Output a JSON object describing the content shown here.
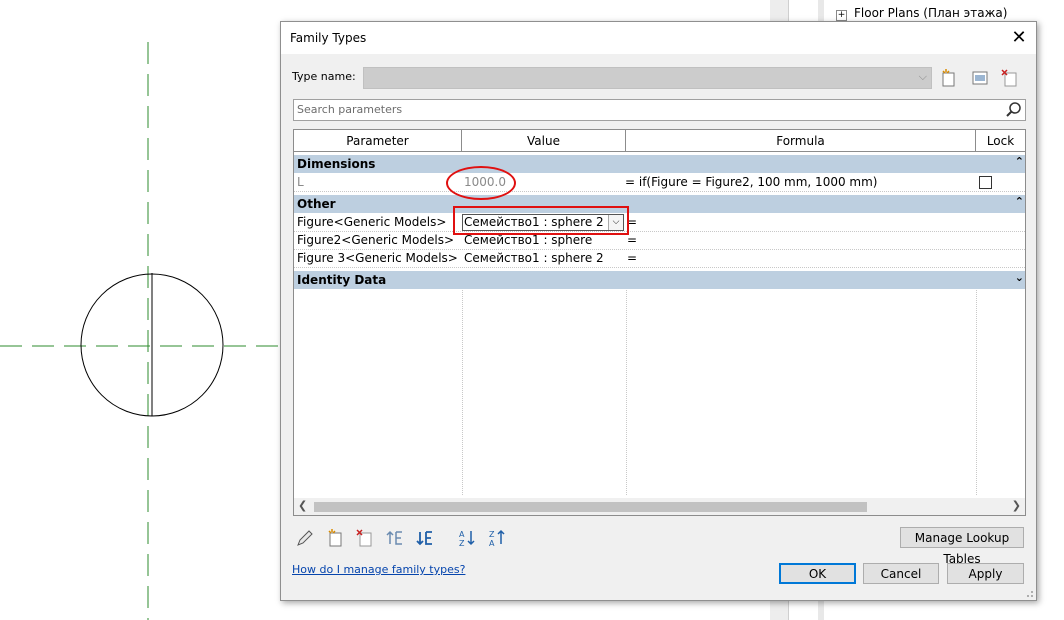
{
  "background": {
    "project_browser_item": "Floor Plans (План этажа)"
  },
  "dialog": {
    "title": "Family Types",
    "close_icon": "close-icon",
    "type_name_label": "Type name:",
    "type_name_value": "",
    "search_placeholder": "Search parameters",
    "columns": [
      "Parameter",
      "Value",
      "Formula",
      "Lock"
    ],
    "groups": [
      {
        "name": "Dimensions",
        "rows": [
          {
            "parameter": "L",
            "value": "1000.0",
            "formula": "= if(Figure = Figure2, 100 mm, 1000 mm)",
            "lock": false,
            "greyed": true
          }
        ]
      },
      {
        "name": "Other",
        "rows": [
          {
            "parameter": "Figure<Generic Models>",
            "value": "Семейство1 : sphere 2",
            "formula": "=",
            "active": true
          },
          {
            "parameter": "Figure2<Generic Models>",
            "value": "Семейство1 : sphere",
            "formula": "="
          },
          {
            "parameter": "Figure 3<Generic Models>",
            "value": "Семейство1 : sphere 2",
            "formula": "="
          }
        ]
      },
      {
        "name": "Identity Data",
        "rows": []
      }
    ],
    "buttons": {
      "manage_lookup": "Manage Lookup Tables",
      "ok": "OK",
      "cancel": "Cancel",
      "apply": "Apply"
    },
    "help_link": "How do I manage family types?"
  },
  "colors": {
    "group_header": "#bdcfe0",
    "annotation": "#e01010",
    "dashed_line": "#2e8b2e"
  }
}
